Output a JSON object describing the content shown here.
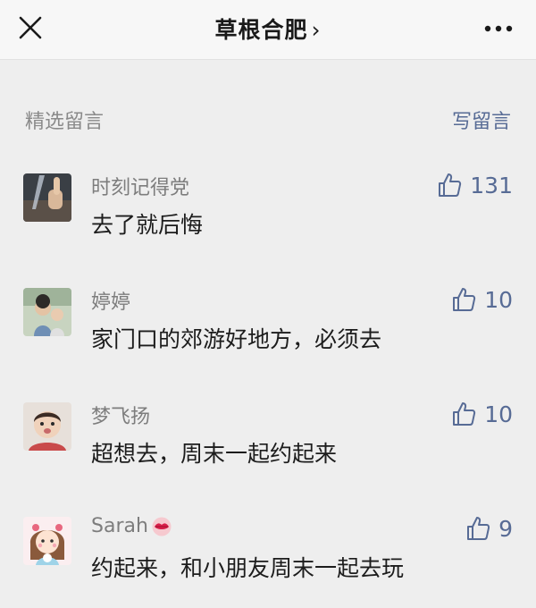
{
  "header": {
    "title": "草根合肥",
    "title_chevron": "›",
    "close_icon": "close-icon",
    "more_icon": "more-icon"
  },
  "section": {
    "title": "精选留言",
    "write_label": "写留言"
  },
  "comments": [
    {
      "name": "时刻记得党",
      "text": "去了就后悔",
      "likes": "131",
      "avatar": "thumbs-up-photo"
    },
    {
      "name": "婷婷",
      "text": "家门口的郊游好地方，必须去",
      "likes": "10",
      "avatar": "family-photo"
    },
    {
      "name": "梦飞扬",
      "text": "超想去，周末一起约起来",
      "likes": "10",
      "avatar": "child-photo"
    },
    {
      "name": "Sarah",
      "text": "约起来，和小朋友周末一起去玩",
      "likes": "9",
      "avatar": "cartoon-girl",
      "name_emoji": "lips-emoji"
    }
  ],
  "colors": {
    "accent": "#576b95",
    "background": "#eeeeee",
    "header_bg": "#f7f7f7"
  }
}
